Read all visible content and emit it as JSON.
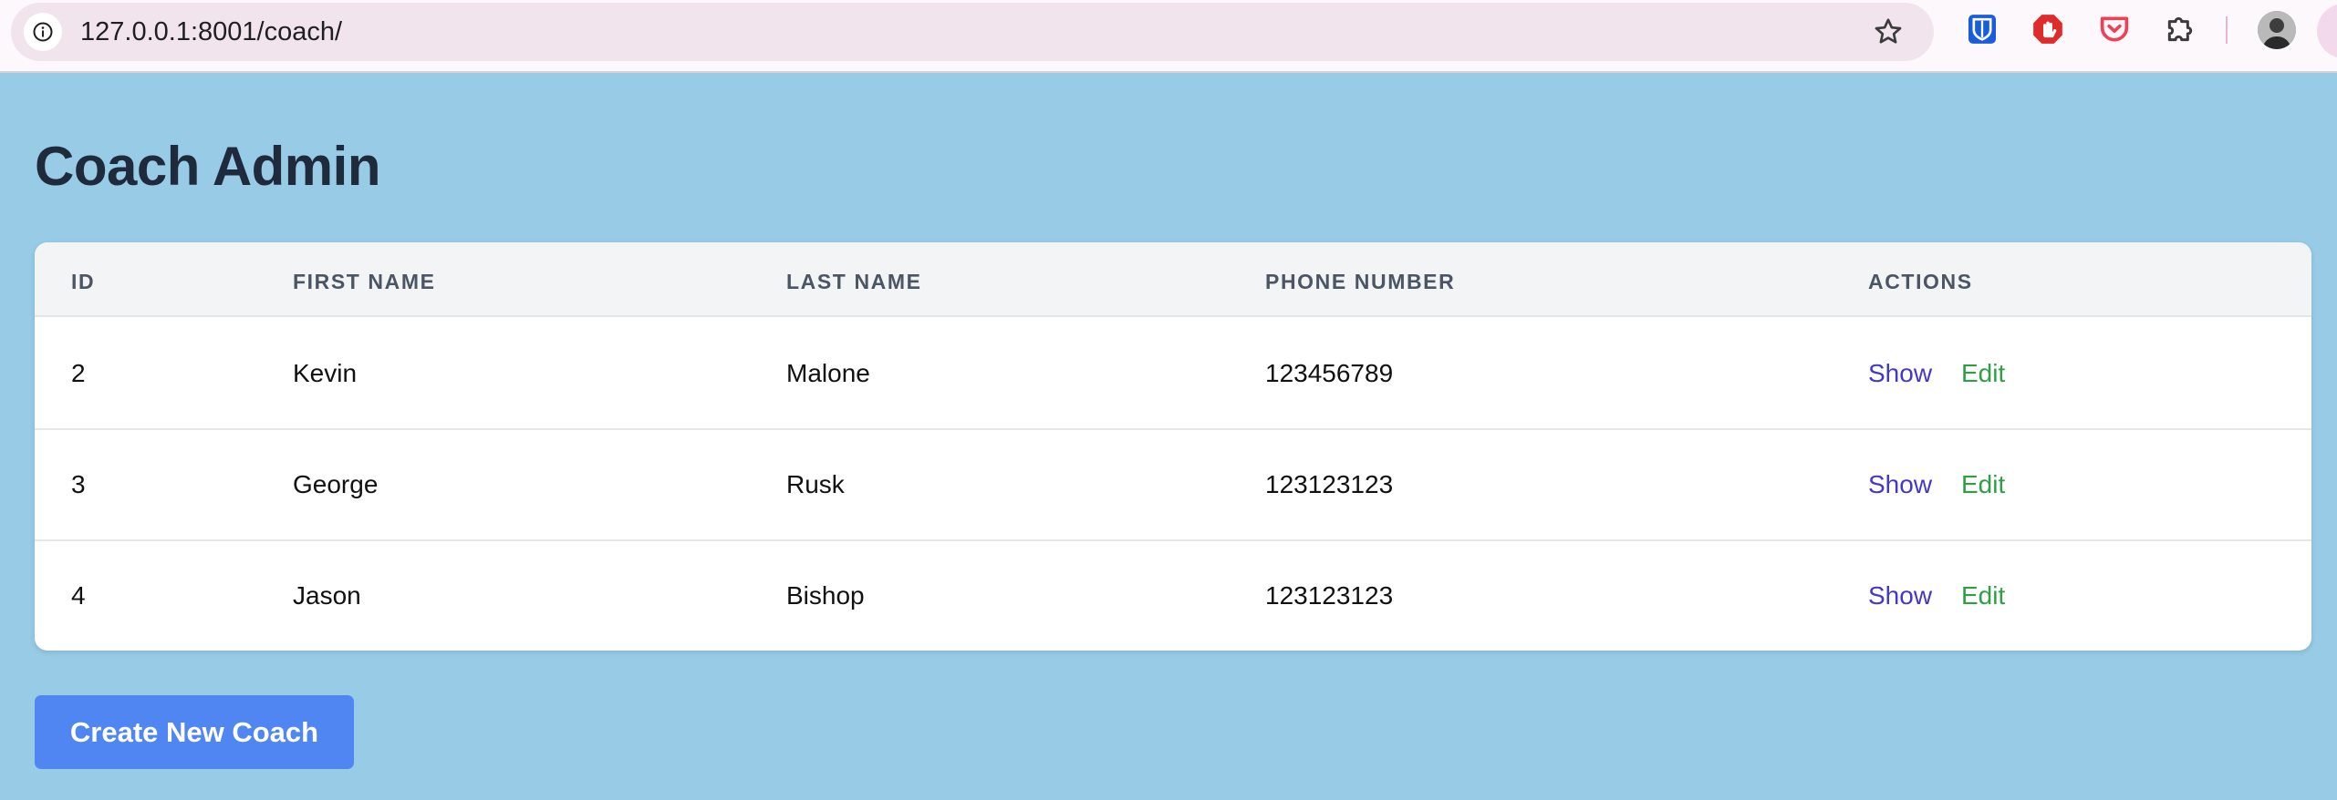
{
  "browser": {
    "url": "127.0.0.1:8001/coach/",
    "icons": [
      "info-icon",
      "star-icon",
      "bitwarden-icon",
      "adblock-icon",
      "pocket-icon",
      "extensions-puzzle-icon",
      "profile-avatar"
    ]
  },
  "page": {
    "title": "Coach Admin"
  },
  "table": {
    "headers": {
      "id": "ID",
      "first_name": "FIRST NAME",
      "last_name": "LAST NAME",
      "phone": "PHONE NUMBER",
      "actions": "ACTIONS"
    },
    "rows": [
      {
        "id": "2",
        "first_name": "Kevin",
        "last_name": "Malone",
        "phone": "123456789",
        "show": "Show",
        "edit": "Edit"
      },
      {
        "id": "3",
        "first_name": "George",
        "last_name": "Rusk",
        "phone": "123123123",
        "show": "Show",
        "edit": "Edit"
      },
      {
        "id": "4",
        "first_name": "Jason",
        "last_name": "Bishop",
        "phone": "123123123",
        "show": "Show",
        "edit": "Edit"
      }
    ]
  },
  "actions": {
    "create_label": "Create New Coach"
  },
  "colors": {
    "page_background": "#97cbe6",
    "title": "#1f2a3d",
    "show_link": "#4338ca",
    "edit_link": "#2f9e44",
    "primary_button": "#4f86f2"
  }
}
